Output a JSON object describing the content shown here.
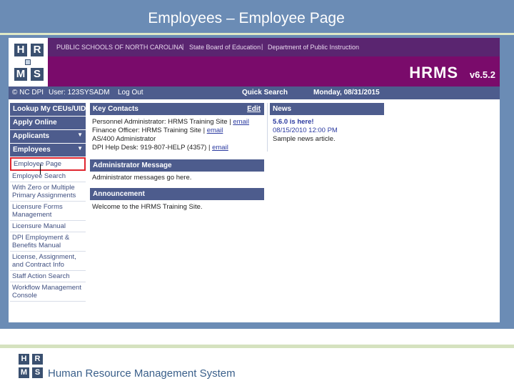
{
  "slide": {
    "title": "Employees – Employee Page",
    "footer_text": "Human Resource Management System"
  },
  "logo": {
    "letters": [
      "H",
      "R",
      "M",
      "S"
    ]
  },
  "header": {
    "links": [
      "PUBLIC SCHOOLS OF NORTH CAROLINA",
      "State Board of Education",
      "Department of Public Instruction"
    ],
    "separator": "|",
    "app_name": "HRMS",
    "version": "v6.5.2"
  },
  "navbar": {
    "copyright": "© NC DPI",
    "user": "User: 123SYSADM",
    "logout": "Log Out",
    "quick_search": "Quick Search",
    "date": "Monday, 08/31/2015"
  },
  "menu": {
    "items": [
      {
        "label": "Lookup My CEUs/UID",
        "arrow": false
      },
      {
        "label": "Apply Online",
        "arrow": false
      },
      {
        "label": "Applicants",
        "arrow": true
      },
      {
        "label": "Employees",
        "arrow": true
      }
    ],
    "arrow_glyph": "▼",
    "sub_items": [
      {
        "label": "Employee Page",
        "selected": true
      },
      {
        "label": "Employee Search",
        "selected": false
      },
      {
        "label": "With Zero or Multiple Primary Assignments",
        "selected": false
      },
      {
        "label": "Licensure Forms Management",
        "selected": false
      },
      {
        "label": "Licensure Manual",
        "selected": false
      },
      {
        "label": "DPI Employment & Benefits Manual",
        "selected": false
      },
      {
        "label": "License, Assignment, and Contract Info",
        "selected": false
      },
      {
        "label": "Staff Action Search",
        "selected": false
      },
      {
        "label": "Workflow Management Console",
        "selected": false
      }
    ]
  },
  "key_contacts": {
    "title": "Key Contacts",
    "edit": "Edit",
    "line1": "Personnel Administrator: HRMS Training Site |",
    "line1_link": "email",
    "line2": "Finance Officer: HRMS Training Site |",
    "line2_link": "email",
    "line3": "AS/400 Administrator",
    "line4": "DPI Help Desk: 919-807-HELP (4357) |",
    "line4_link": "email"
  },
  "news": {
    "title": "News",
    "headline": "5.6.0 is here!",
    "date": "08/15/2010 12:00 PM",
    "body": "Sample news article."
  },
  "admin_message": {
    "title": "Administrator Message",
    "body": "Administrator messages go here."
  },
  "announcement": {
    "title": "Announcement",
    "body": "Welcome to the HRMS Training Site."
  },
  "colors": {
    "slide_bg": "#6b8cb5",
    "header_purple": "#7a0b6b",
    "nav_blue": "#4d5c8d",
    "selection_red": "#e0262f"
  }
}
